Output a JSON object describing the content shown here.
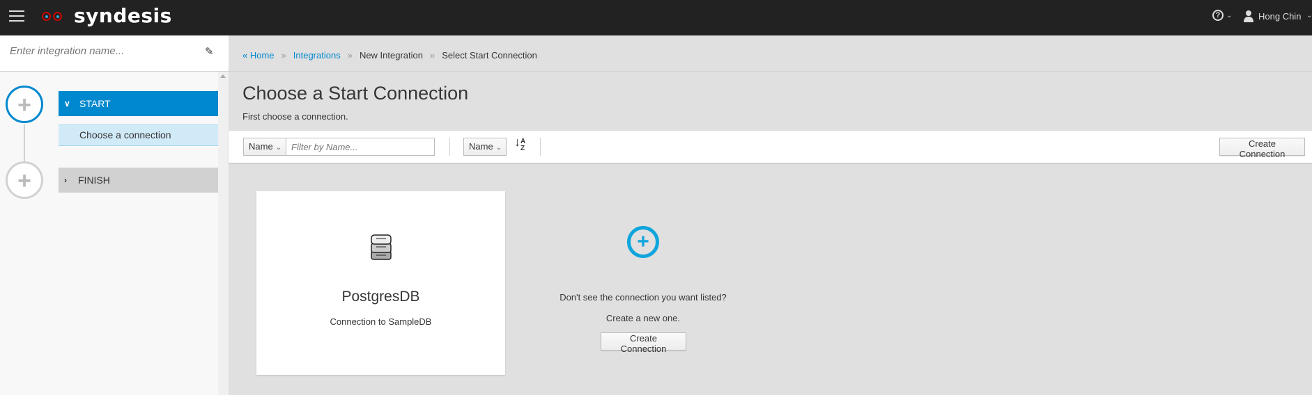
{
  "topbar": {
    "brand": "syndesis",
    "help_icon": "?",
    "caret": "⌄",
    "user_name": "Hong Chin"
  },
  "sidebar": {
    "name_placeholder": "Enter integration name...",
    "steps": [
      {
        "label": "START",
        "sub": "Choose a connection"
      },
      {
        "label": "FINISH"
      }
    ],
    "plus": "+"
  },
  "breadcrumb": {
    "home": "« Home",
    "integrations": "Integrations",
    "new_integration": "New Integration",
    "current": "Select Start Connection",
    "sep": "»"
  },
  "page": {
    "title": "Choose a Start Connection",
    "subtitle": "First choose a connection."
  },
  "toolbar": {
    "filter_field": "Name",
    "filter_placeholder": "Filter by Name...",
    "sort_field": "Name",
    "sort_icon": "↓A\nZ",
    "create_label": "Create Connection"
  },
  "connections": [
    {
      "name": "PostgresDB",
      "description": "Connection to SampleDB"
    }
  ],
  "new_connection": {
    "question": "Don't see the connection you want listed?",
    "prompt": "Create a new one.",
    "button": "Create Connection",
    "plus": "+"
  },
  "colors": {
    "accent": "#0088ce",
    "topbar": "#222222",
    "plus": "#0ea5dc"
  }
}
